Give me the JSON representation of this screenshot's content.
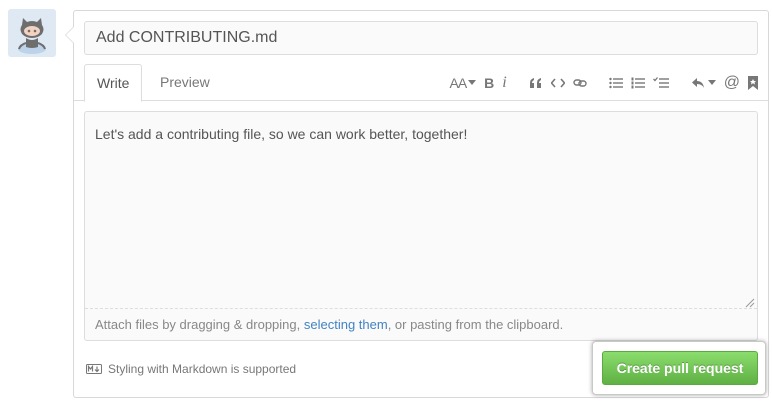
{
  "avatar": {
    "icon": "octocat-icon"
  },
  "form": {
    "title_value": "Add CONTRIBUTING.md",
    "tabs": [
      {
        "label": "Write",
        "active": true
      },
      {
        "label": "Preview",
        "active": false
      }
    ],
    "toolbar": {
      "text_size": "AA",
      "bold": "B",
      "italic": "i"
    },
    "body_value": "Let's add a contributing file, so we can work better, together!",
    "attach": {
      "prefix": "Attach files by dragging & dropping, ",
      "link": "selecting them",
      "suffix": ", or pasting from the clipboard."
    },
    "markdown_note": "Styling with Markdown is supported",
    "submit_label": "Create pull request"
  },
  "colors": {
    "accent_green": "#60b044",
    "link_blue": "#4183c4"
  }
}
